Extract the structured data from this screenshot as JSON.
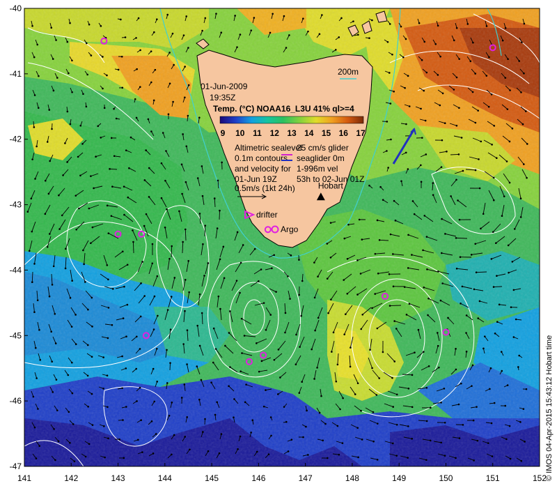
{
  "map": {
    "date": "01-Jun-2009",
    "time": "19:35Z",
    "product": "Temp. (°C) NOAA16_L3U 41% ql>=4",
    "colorbar_labels": [
      "9",
      "10",
      "11",
      "12",
      "13",
      "14",
      "15",
      "16",
      "17"
    ],
    "colorbar_colors": [
      "#1a0a78",
      "#1f3fc8",
      "#12a0e0",
      "#16c4a0",
      "#2cc060",
      "#86d23c",
      "#e0dc2a",
      "#f0a020",
      "#d45a10",
      "#7a2a08"
    ],
    "contour_note": [
      "Altimetric sealevel",
      "0.1m contours",
      "and velocity for",
      "01-Jun 19Z"
    ],
    "velocity_scale": "0.5m/s (1kt 24h)",
    "seaglider_note": [
      "25 cm/s glider",
      "seaglider 0m",
      "1-996m vel",
      "53h to 02-Jun 01Z"
    ],
    "isobath_label": "200m",
    "city_label": "Hobart",
    "drifter_label": "drifter",
    "argo_label": "Argo",
    "credit": "© IMOS 04-Apr-2015 15:43:12 Hobart time",
    "x_ticks": [
      "141",
      "142",
      "143",
      "144",
      "145",
      "146",
      "147",
      "148",
      "149",
      "150",
      "151",
      "152"
    ],
    "y_ticks": [
      "-40",
      "-41",
      "-42",
      "-43",
      "-44",
      "-45",
      "-46",
      "-47"
    ],
    "x_range": [
      141,
      152
    ],
    "y_range": [
      -47,
      -40
    ],
    "argo_floats": [
      {
        "lon": 142.7,
        "lat": -40.5
      },
      {
        "lon": 143.0,
        "lat": -43.45
      },
      {
        "lon": 143.5,
        "lat": -43.45
      },
      {
        "lon": 143.6,
        "lat": -45.0
      },
      {
        "lon": 145.8,
        "lat": -45.4
      },
      {
        "lon": 146.1,
        "lat": -45.3
      },
      {
        "lon": 148.7,
        "lat": -44.4
      },
      {
        "lon": 150.0,
        "lat": -44.95
      },
      {
        "lon": 151.0,
        "lat": -40.6
      },
      {
        "lon": 146.2,
        "lat": -43.38
      }
    ],
    "hobart": {
      "lon": 147.33,
      "lat": -42.88
    }
  }
}
